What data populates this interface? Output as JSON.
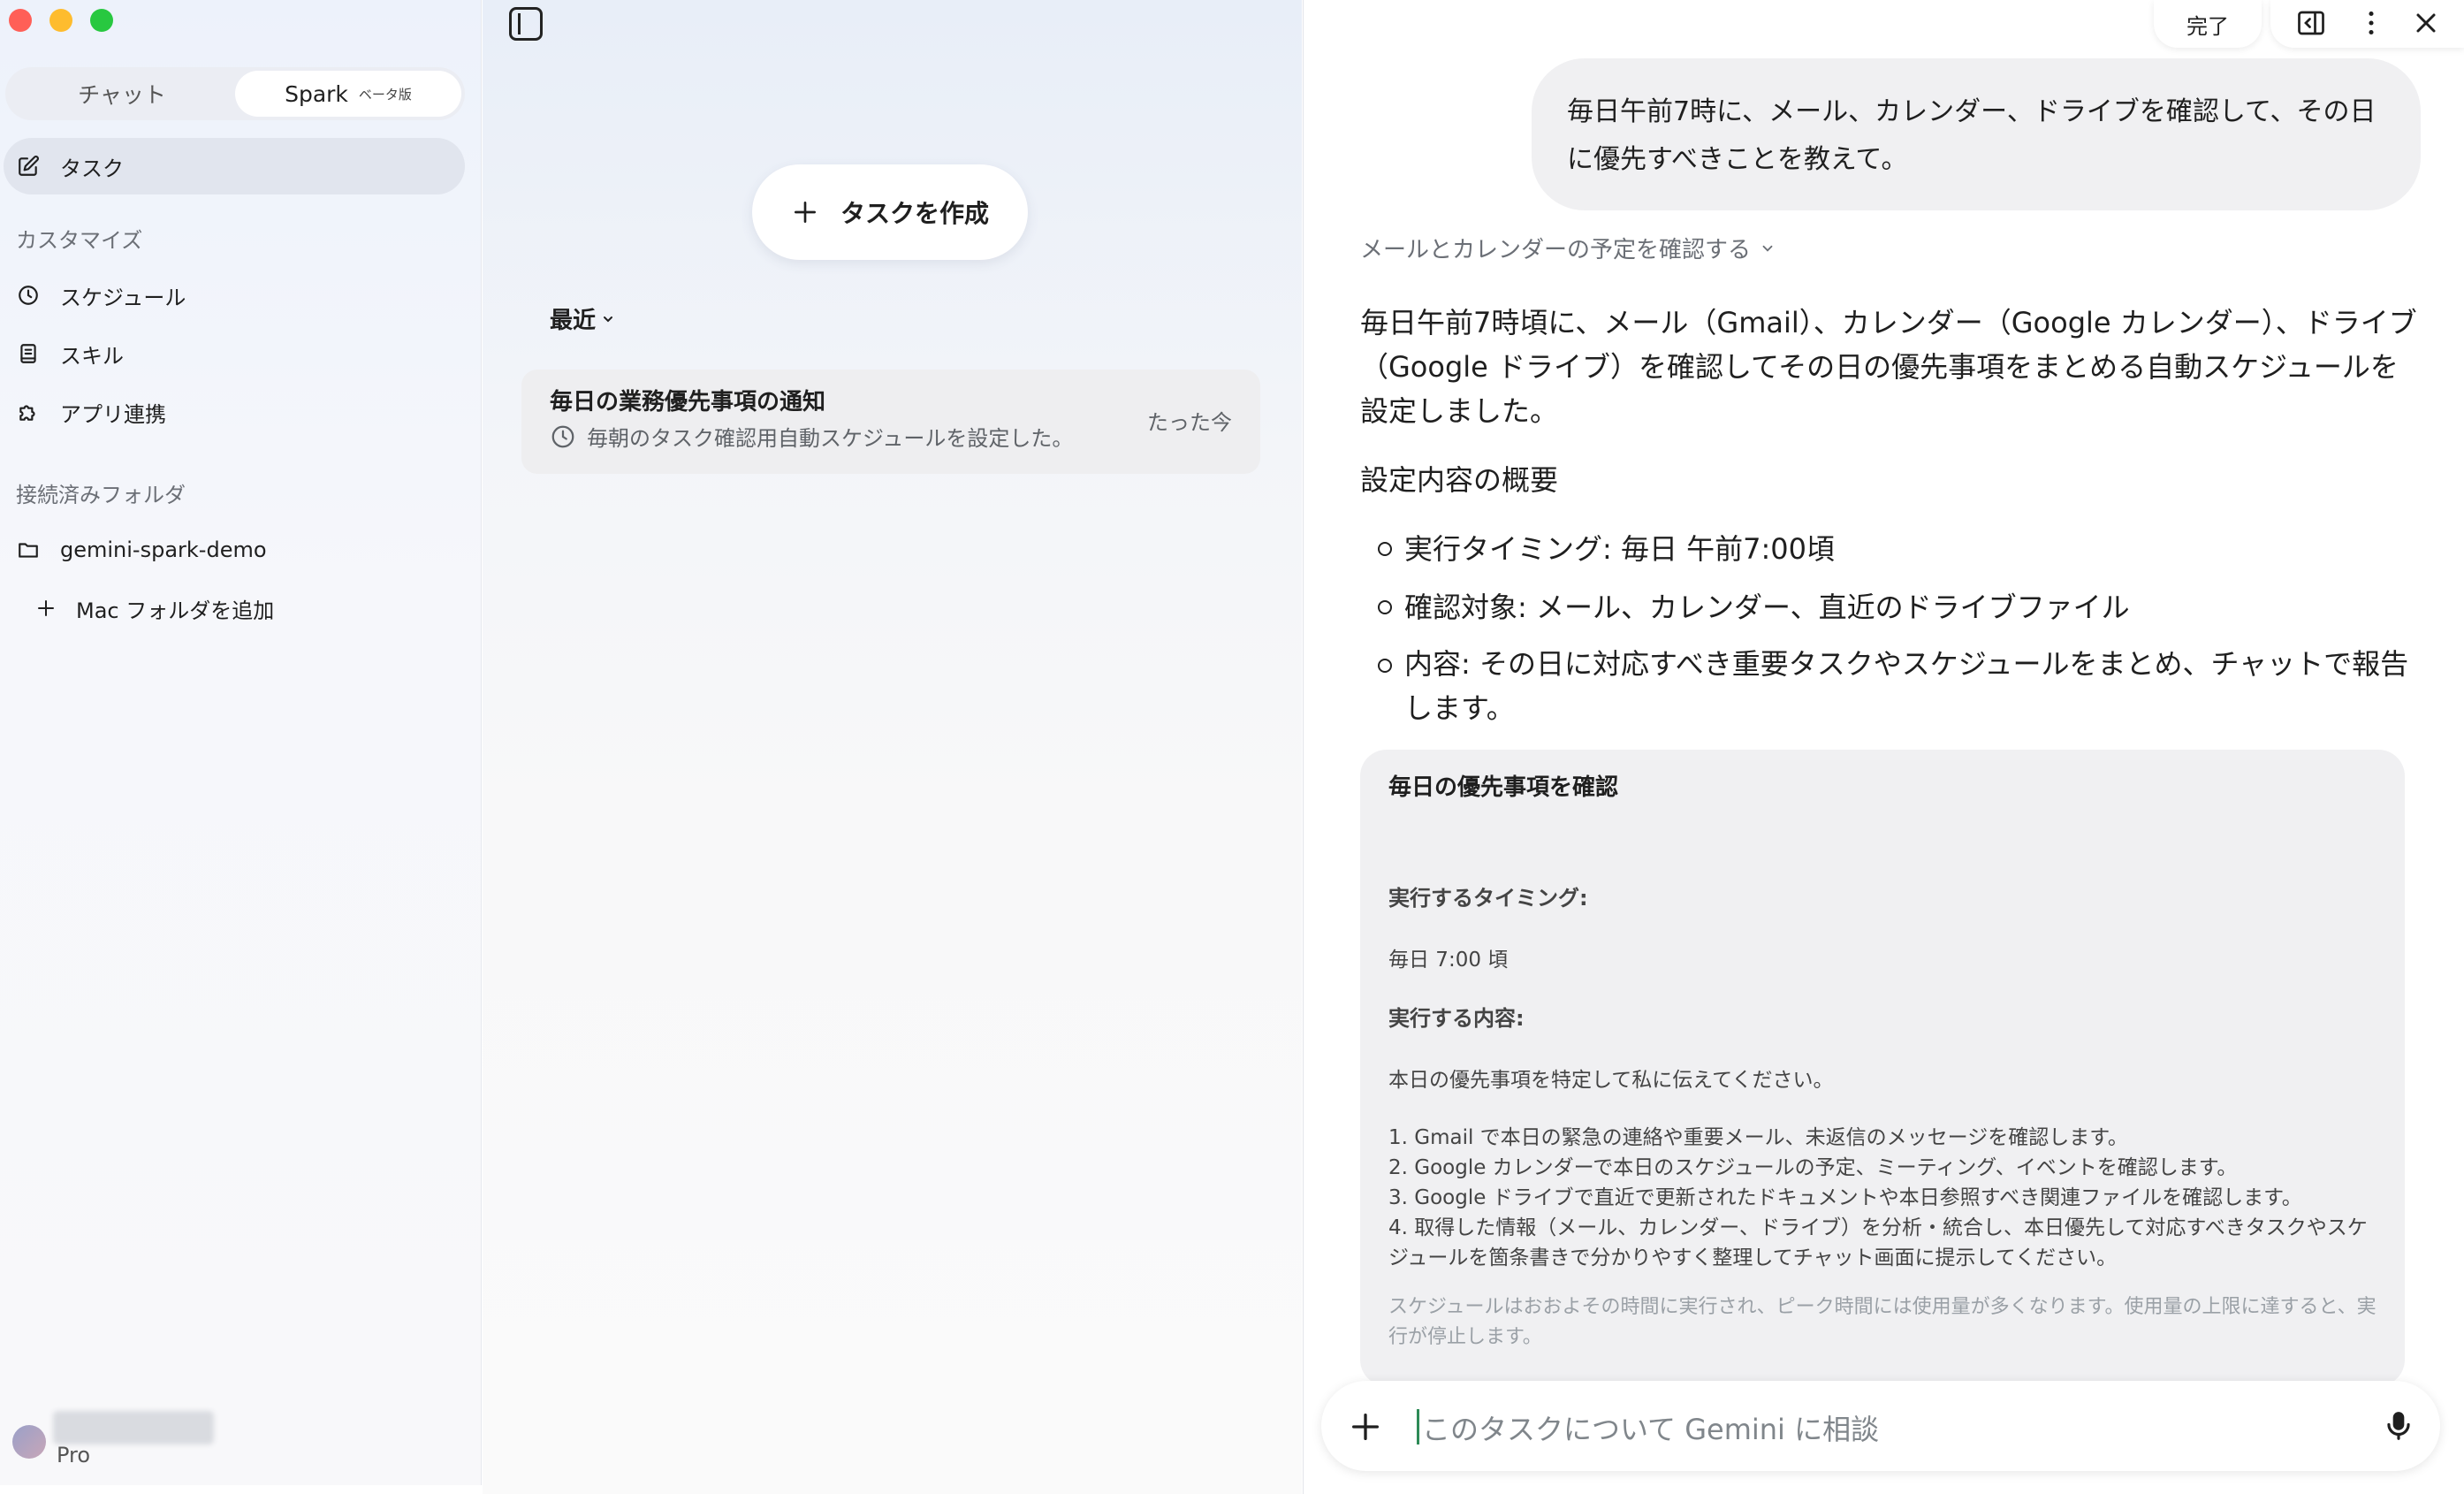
{
  "sidebar": {
    "tabs": [
      {
        "label": "チャット"
      },
      {
        "label": "Spark",
        "badge": "ベータ版"
      }
    ],
    "nav_task": "タスク",
    "section_customize": "カスタマイズ",
    "customize_items": [
      {
        "label": "スケジュール",
        "icon": "clock-icon"
      },
      {
        "label": "スキル",
        "icon": "book-icon"
      },
      {
        "label": "アプリ連携",
        "icon": "puzzle-icon"
      }
    ],
    "section_folders": "接続済みフォルダ",
    "folder": "gemini-spark-demo",
    "add_folder": "Mac フォルダを追加",
    "user_plan": "Pro"
  },
  "middle": {
    "create_task": "タスクを作成",
    "filter": "最近",
    "tasks": [
      {
        "title": "毎日の業務優先事項の通知",
        "subtitle": "毎朝のタスク確認用自動スケジュールを設定した。",
        "time": "たった今"
      }
    ]
  },
  "right": {
    "topbar": {
      "done": "完了"
    },
    "user_message": "毎日午前7時に、メール、カレンダー、ドライブを確認して、その日に優先すべきことを教えて。",
    "thinking": "メールとカレンダーの予定を確認する",
    "answer_paragraph": "毎日午前7時頃に、メール（Gmail）、カレンダー（Google カレンダー）、ドライブ（Google ドライブ）を確認してその日の優先事項をまとめる自動スケジュールを設定しました。",
    "summary_heading": "設定内容の概要",
    "bullets": [
      "実行タイミング: 毎日 午前7:00頃",
      "確認対象: メール、カレンダー、直近のドライブファイル",
      "内容: その日に対応すべき重要タスクやスケジュールをまとめ、チャットで報告します。"
    ],
    "plan_card": {
      "title": "毎日の優先事項を確認",
      "timing_label": "実行するタイミング:",
      "timing_value": "毎日 7:00 頃",
      "content_label": "実行する内容:",
      "content_intro": "本日の優先事項を特定して私に伝えてください。",
      "steps": [
        "1. Gmail で本日の緊急の連絡や重要メール、未返信のメッセージを確認します。",
        "2. Google カレンダーで本日のスケジュールの予定、ミーティング、イベントを確認します。",
        "3. Google ドライブで直近で更新されたドキュメントや本日参照すべき関連ファイルを確認します。",
        "4. 取得した情報（メール、カレンダー、ドライブ）を分析・統合し、本日優先して対応すべきタスクやスケジュールを箇条書きで分かりやすく整理してチャット画面に提示してください。"
      ],
      "note": "スケジュールはおおよその時間に実行され、ピーク時間には使用量が多くなります。使用量の上限に達すると、実行が停止します。"
    },
    "composer_placeholder": "このタスクについて Gemini に相談"
  },
  "colors": {
    "close": "#ff5f57",
    "minimize": "#febc2e",
    "maximize": "#28c840",
    "caret": "#2e8b57"
  }
}
